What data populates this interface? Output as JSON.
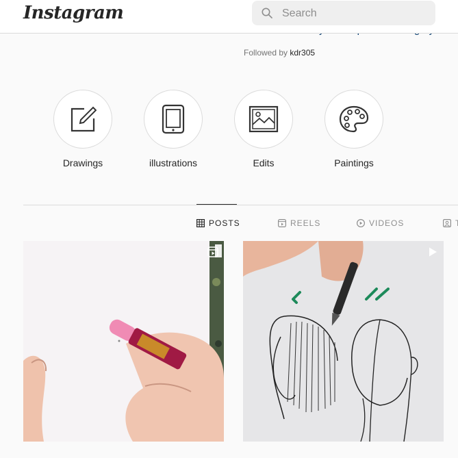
{
  "header": {
    "logo": "Instagram",
    "search": {
      "placeholder": "Search"
    }
  },
  "profile": {
    "link_partial": "www.nchaarts.tay.o.com/product-category/",
    "followed_by_prefix": "Followed by",
    "followed_by_user": "kdr305"
  },
  "highlights": [
    {
      "label": "Drawings",
      "icon": "pencil-square-icon"
    },
    {
      "label": "illustrations",
      "icon": "tablet-icon"
    },
    {
      "label": "Edits",
      "icon": "image-icon"
    },
    {
      "label": "Paintings",
      "icon": "palette-icon"
    }
  ],
  "tabs": [
    {
      "label": "POSTS",
      "icon": "grid-icon",
      "active": true
    },
    {
      "label": "REELS",
      "icon": "reels-icon"
    },
    {
      "label": "VIDEOS",
      "icon": "play-icon"
    },
    {
      "label": "T",
      "icon": "tagged-icon"
    }
  ],
  "posts": [
    {
      "type": "reel",
      "badge_icon": "reels-icon"
    },
    {
      "type": "video",
      "badge_icon": "play-icon"
    }
  ],
  "colors": {
    "link": "#00376b",
    "border": "#dbdbdb",
    "muted": "#8e8e8e"
  }
}
